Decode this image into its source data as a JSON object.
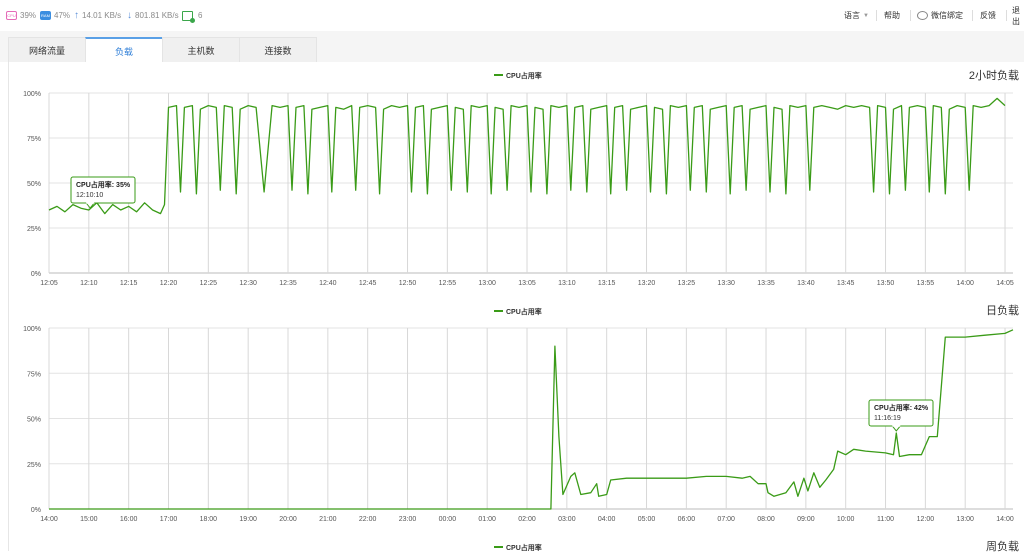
{
  "topbar": {
    "cpu": {
      "badge": "CPU",
      "value": "39%"
    },
    "ram": {
      "badge": "RAM",
      "value": "47%"
    },
    "upload": "14.01 KB/s",
    "download": "801.81 KB/s",
    "hosts": "6",
    "menu": {
      "language": "语言",
      "help": "帮助",
      "wechat": "微信绑定",
      "feedback": "反馈",
      "logout": "退出"
    }
  },
  "tabs": [
    {
      "label": "网络流量",
      "active": false
    },
    {
      "label": "负载",
      "active": true
    },
    {
      "label": "主机数",
      "active": false
    },
    {
      "label": "连接数",
      "active": false
    }
  ],
  "colors": {
    "series": "#3a9b17",
    "grid": "#d8d8d8",
    "accent": "#2f7fd8"
  },
  "chart_data": [
    {
      "type": "line",
      "title": "2小时负载",
      "legend": "CPU占用率",
      "y_ticks": [
        "0%",
        "25%",
        "50%",
        "75%",
        "100%"
      ],
      "ylim": [
        0,
        100
      ],
      "x_ticks": [
        "12:05",
        "12:10",
        "12:15",
        "12:20",
        "12:25",
        "12:30",
        "12:35",
        "12:40",
        "12:45",
        "12:50",
        "12:55",
        "13:00",
        "13:05",
        "13:10",
        "13:15",
        "13:20",
        "13:25",
        "13:30",
        "13:35",
        "13:40",
        "13:45",
        "13:50",
        "13:55",
        "14:00",
        "14:05"
      ],
      "xlim": [
        "12:05",
        "14:06"
      ],
      "tooltip": {
        "label": "CPU占用率: 35%",
        "time": "12:10:10",
        "x": "12:10:10",
        "y": 35
      },
      "points": [
        [
          "12:05",
          35
        ],
        [
          "12:06",
          37
        ],
        [
          "12:07",
          34
        ],
        [
          "12:08",
          38
        ],
        [
          "12:09",
          36
        ],
        [
          "12:10",
          35
        ],
        [
          "12:11",
          39
        ],
        [
          "12:12",
          33
        ],
        [
          "12:13",
          38
        ],
        [
          "12:14",
          35
        ],
        [
          "12:15",
          37
        ],
        [
          "12:16",
          34
        ],
        [
          "12:17",
          39
        ],
        [
          "12:18",
          35
        ],
        [
          "12:19",
          33
        ],
        [
          "12:19:30",
          38
        ],
        [
          "12:20",
          92
        ],
        [
          "12:21",
          93
        ],
        [
          "12:21:30",
          45
        ],
        [
          "12:22",
          92
        ],
        [
          "12:23",
          93
        ],
        [
          "12:23:30",
          44
        ],
        [
          "12:24",
          91
        ],
        [
          "12:25",
          93
        ],
        [
          "12:26",
          92
        ],
        [
          "12:26:30",
          46
        ],
        [
          "12:27",
          93
        ],
        [
          "12:28",
          92
        ],
        [
          "12:28:30",
          44
        ],
        [
          "12:29",
          91
        ],
        [
          "12:30",
          93
        ],
        [
          "12:31",
          92
        ],
        [
          "12:32",
          45
        ],
        [
          "12:33",
          93
        ],
        [
          "12:34",
          92
        ],
        [
          "12:35",
          93
        ],
        [
          "12:35:30",
          46
        ],
        [
          "12:36",
          92
        ],
        [
          "12:37",
          93
        ],
        [
          "12:37:30",
          44
        ],
        [
          "12:38",
          91
        ],
        [
          "12:39",
          92
        ],
        [
          "12:40",
          93
        ],
        [
          "12:40:30",
          45
        ],
        [
          "12:41",
          92
        ],
        [
          "12:42",
          91
        ],
        [
          "12:43",
          93
        ],
        [
          "12:43:30",
          46
        ],
        [
          "12:44",
          92
        ],
        [
          "12:45",
          93
        ],
        [
          "12:46",
          92
        ],
        [
          "12:46:30",
          44
        ],
        [
          "12:47",
          91
        ],
        [
          "12:48",
          93
        ],
        [
          "12:49",
          92
        ],
        [
          "12:50",
          93
        ],
        [
          "12:50:30",
          45
        ],
        [
          "12:51",
          92
        ],
        [
          "12:52",
          93
        ],
        [
          "12:52:30",
          44
        ],
        [
          "12:53",
          91
        ],
        [
          "12:54",
          92
        ],
        [
          "12:55",
          93
        ],
        [
          "12:55:30",
          46
        ],
        [
          "12:56",
          92
        ],
        [
          "12:57",
          91
        ],
        [
          "12:57:30",
          45
        ],
        [
          "12:58",
          93
        ],
        [
          "12:59",
          92
        ],
        [
          "13:00",
          93
        ],
        [
          "13:00:30",
          44
        ],
        [
          "13:01",
          92
        ],
        [
          "13:02",
          91
        ],
        [
          "13:02:30",
          46
        ],
        [
          "13:03",
          93
        ],
        [
          "13:04",
          92
        ],
        [
          "13:05",
          93
        ],
        [
          "13:05:30",
          45
        ],
        [
          "13:06",
          92
        ],
        [
          "13:07",
          91
        ],
        [
          "13:07:30",
          44
        ],
        [
          "13:08",
          93
        ],
        [
          "13:09",
          92
        ],
        [
          "13:10",
          93
        ],
        [
          "13:10:30",
          46
        ],
        [
          "13:11",
          92
        ],
        [
          "13:12",
          93
        ],
        [
          "13:12:30",
          45
        ],
        [
          "13:13",
          91
        ],
        [
          "13:14",
          92
        ],
        [
          "13:15",
          93
        ],
        [
          "13:15:30",
          44
        ],
        [
          "13:16",
          92
        ],
        [
          "13:17",
          93
        ],
        [
          "13:17:30",
          46
        ],
        [
          "13:18",
          91
        ],
        [
          "13:19",
          92
        ],
        [
          "13:20",
          93
        ],
        [
          "13:20:30",
          45
        ],
        [
          "13:21",
          92
        ],
        [
          "13:22",
          91
        ],
        [
          "13:22:30",
          44
        ],
        [
          "13:23",
          93
        ],
        [
          "13:24",
          92
        ],
        [
          "13:25",
          93
        ],
        [
          "13:25:30",
          46
        ],
        [
          "13:26",
          92
        ],
        [
          "13:27",
          93
        ],
        [
          "13:27:30",
          45
        ],
        [
          "13:28",
          91
        ],
        [
          "13:29",
          92
        ],
        [
          "13:30",
          93
        ],
        [
          "13:30:30",
          44
        ],
        [
          "13:31",
          92
        ],
        [
          "13:32",
          93
        ],
        [
          "13:32:30",
          46
        ],
        [
          "13:33",
          91
        ],
        [
          "13:34",
          92
        ],
        [
          "13:35",
          93
        ],
        [
          "13:35:30",
          45
        ],
        [
          "13:36",
          92
        ],
        [
          "13:37",
          91
        ],
        [
          "13:37:30",
          44
        ],
        [
          "13:38",
          93
        ],
        [
          "13:39",
          92
        ],
        [
          "13:40",
          93
        ],
        [
          "13:40:30",
          46
        ],
        [
          "13:41",
          92
        ],
        [
          "13:42",
          93
        ],
        [
          "13:43",
          92
        ],
        [
          "13:44",
          91
        ],
        [
          "13:45",
          93
        ],
        [
          "13:46",
          92
        ],
        [
          "13:47",
          93
        ],
        [
          "13:48",
          92
        ],
        [
          "13:48:30",
          45
        ],
        [
          "13:49",
          93
        ],
        [
          "13:50",
          92
        ],
        [
          "13:50:30",
          44
        ],
        [
          "13:51",
          91
        ],
        [
          "13:52",
          93
        ],
        [
          "13:52:30",
          46
        ],
        [
          "13:53",
          92
        ],
        [
          "13:54",
          93
        ],
        [
          "13:55",
          92
        ],
        [
          "13:55:30",
          45
        ],
        [
          "13:56",
          93
        ],
        [
          "13:57",
          92
        ],
        [
          "13:57:30",
          44
        ],
        [
          "13:58",
          91
        ],
        [
          "13:59",
          93
        ],
        [
          "14:00",
          92
        ],
        [
          "14:00:30",
          46
        ],
        [
          "14:01",
          93
        ],
        [
          "14:02",
          92
        ],
        [
          "14:03",
          93
        ],
        [
          "14:04",
          97
        ],
        [
          "14:05",
          93
        ]
      ]
    },
    {
      "type": "line",
      "title": "日负载",
      "legend": "CPU占用率",
      "y_ticks": [
        "0%",
        "25%",
        "50%",
        "75%",
        "100%"
      ],
      "ylim": [
        0,
        100
      ],
      "x_ticks": [
        "14:00",
        "15:00",
        "16:00",
        "17:00",
        "18:00",
        "19:00",
        "20:00",
        "21:00",
        "22:00",
        "23:00",
        "00:00",
        "01:00",
        "02:00",
        "03:00",
        "04:00",
        "05:00",
        "06:00",
        "07:00",
        "08:00",
        "09:00",
        "10:00",
        "11:00",
        "12:00",
        "13:00",
        "14:00"
      ],
      "xlim_hours_from_first_tick": [
        0,
        24.2
      ],
      "tooltip": {
        "label": "CPU占用率: 42%",
        "time": "11:16:19",
        "x_hours_from_first_tick": 21.27,
        "y": 42
      },
      "points": [
        [
          0,
          0
        ],
        [
          2,
          0
        ],
        [
          4,
          0
        ],
        [
          6,
          0
        ],
        [
          8,
          0
        ],
        [
          10,
          0
        ],
        [
          12,
          0
        ],
        [
          12.6,
          0
        ],
        [
          12.7,
          90
        ],
        [
          12.8,
          40
        ],
        [
          12.9,
          8
        ],
        [
          13.1,
          18
        ],
        [
          13.2,
          20
        ],
        [
          13.35,
          8
        ],
        [
          13.6,
          9
        ],
        [
          13.75,
          14
        ],
        [
          13.8,
          7
        ],
        [
          14.0,
          8
        ],
        [
          14.1,
          16
        ],
        [
          14.5,
          17
        ],
        [
          15,
          17
        ],
        [
          15.5,
          17
        ],
        [
          16,
          17
        ],
        [
          16.5,
          18
        ],
        [
          17,
          18
        ],
        [
          17.4,
          17
        ],
        [
          17.6,
          18
        ],
        [
          17.8,
          14
        ],
        [
          18,
          14
        ],
        [
          18.05,
          9
        ],
        [
          18.2,
          7
        ],
        [
          18.5,
          9
        ],
        [
          18.7,
          15
        ],
        [
          18.8,
          7
        ],
        [
          18.95,
          17
        ],
        [
          19.05,
          10
        ],
        [
          19.2,
          20
        ],
        [
          19.35,
          12
        ],
        [
          19.5,
          16
        ],
        [
          19.7,
          22
        ],
        [
          19.8,
          32
        ],
        [
          20.0,
          30
        ],
        [
          20.2,
          33
        ],
        [
          20.5,
          32
        ],
        [
          21.0,
          31
        ],
        [
          21.2,
          30
        ],
        [
          21.27,
          42
        ],
        [
          21.35,
          29
        ],
        [
          21.6,
          30
        ],
        [
          21.9,
          30
        ],
        [
          22.1,
          40
        ],
        [
          22.3,
          40
        ],
        [
          22.5,
          95
        ],
        [
          23,
          95
        ],
        [
          23.5,
          96
        ],
        [
          24,
          97
        ],
        [
          24.2,
          99
        ]
      ]
    },
    {
      "type": "line",
      "title": "周负载",
      "legend": "CPU占用率"
    }
  ]
}
